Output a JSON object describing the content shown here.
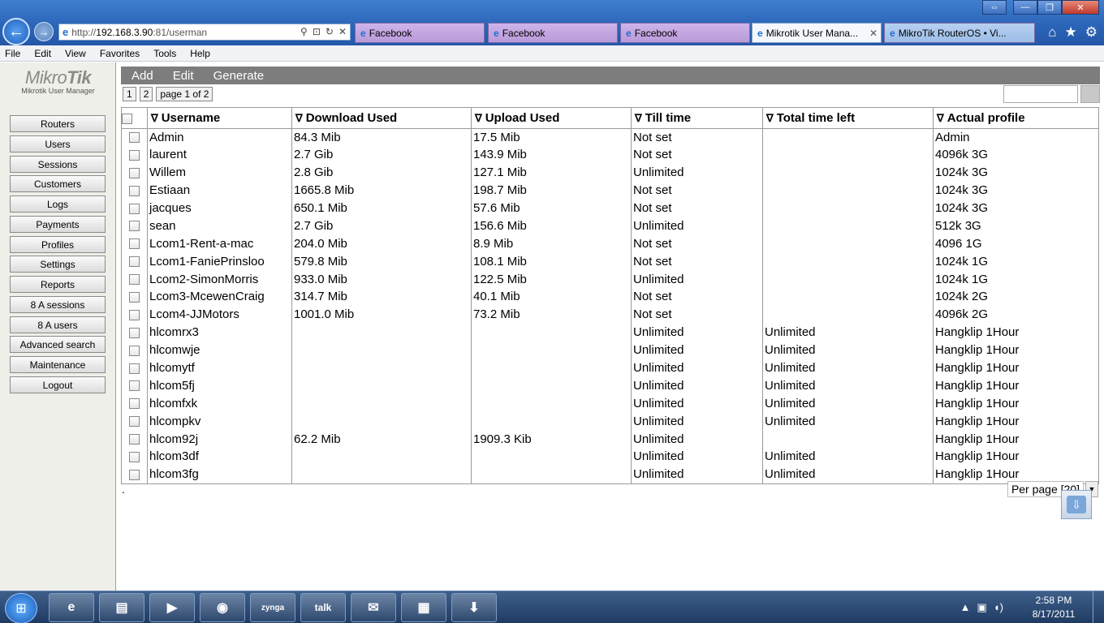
{
  "browser": {
    "address": {
      "prefix": "http://",
      "host": "192.168.3.90",
      "suffix": ":81/userman"
    },
    "tabs": [
      {
        "label": "Facebook",
        "active": false
      },
      {
        "label": "Facebook",
        "active": false
      },
      {
        "label": "Facebook",
        "active": false
      },
      {
        "label": "Mikrotik User Mana...",
        "active": true
      },
      {
        "label": "MikroTik RouterOS • Vi...",
        "active": false
      }
    ],
    "menu": [
      "File",
      "Edit",
      "View",
      "Favorites",
      "Tools",
      "Help"
    ]
  },
  "logo": {
    "main_a": "Mikro",
    "main_b": "Tik",
    "sub": "Mikrotik User Manager"
  },
  "sidebar": {
    "items": [
      "Routers",
      "Users",
      "Sessions",
      "Customers",
      "Logs",
      "Payments",
      "Profiles",
      "Settings",
      "Reports",
      "8 A sessions",
      "8 A users",
      "Advanced search",
      "Maintenance",
      "Logout"
    ]
  },
  "toolbar": {
    "add": "Add",
    "edit": "Edit",
    "generate": "Generate"
  },
  "pager": {
    "p1": "1",
    "p2": "2",
    "info": "page 1 of 2"
  },
  "table": {
    "sort_glyph": "∇",
    "headers": [
      "Username",
      "Download Used",
      "Upload Used",
      "Till time",
      "Total time left",
      "Actual profile"
    ],
    "rows": [
      [
        "Admin",
        "84.3 Mib",
        "17.5 Mib",
        "Not set",
        "",
        "Admin"
      ],
      [
        "laurent",
        "2.7 Gib",
        "143.9 Mib",
        "Not set",
        "",
        "4096k 3G"
      ],
      [
        "Willem",
        "2.8 Gib",
        "127.1 Mib",
        "Unlimited",
        "",
        "1024k 3G"
      ],
      [
        "Estiaan",
        "1665.8 Mib",
        "198.7 Mib",
        "Not set",
        "",
        "1024k 3G"
      ],
      [
        "jacques",
        "650.1 Mib",
        "57.6 Mib",
        "Not set",
        "",
        "1024k 3G"
      ],
      [
        "sean",
        "2.7 Gib",
        "156.6 Mib",
        "Unlimited",
        "",
        "512k 3G"
      ],
      [
        "Lcom1-Rent-a-mac",
        "204.0 Mib",
        "8.9 Mib",
        "Not set",
        "",
        "4096 1G"
      ],
      [
        "Lcom1-FaniePrinsloo",
        "579.8 Mib",
        "108.1 Mib",
        "Not set",
        "",
        "1024k 1G"
      ],
      [
        "Lcom2-SimonMorris",
        "933.0 Mib",
        "122.5 Mib",
        "Unlimited",
        "",
        "1024k 1G"
      ],
      [
        "Lcom3-McewenCraig",
        "314.7 Mib",
        "40.1 Mib",
        "Not set",
        "",
        "1024k 2G"
      ],
      [
        "Lcom4-JJMotors",
        "1001.0 Mib",
        "73.2 Mib",
        "Not set",
        "",
        "4096k 2G"
      ],
      [
        "hlcomrx3",
        "",
        "",
        "Unlimited",
        "Unlimited",
        "Hangklip 1Hour"
      ],
      [
        "hlcomwje",
        "",
        "",
        "Unlimited",
        "Unlimited",
        "Hangklip 1Hour"
      ],
      [
        "hlcomytf",
        "",
        "",
        "Unlimited",
        "Unlimited",
        "Hangklip 1Hour"
      ],
      [
        "hlcom5fj",
        "",
        "",
        "Unlimited",
        "Unlimited",
        "Hangklip 1Hour"
      ],
      [
        "hlcomfxk",
        "",
        "",
        "Unlimited",
        "Unlimited",
        "Hangklip 1Hour"
      ],
      [
        "hlcompkv",
        "",
        "",
        "Unlimited",
        "Unlimited",
        "Hangklip 1Hour"
      ],
      [
        "hlcom92j",
        "62.2 Mib",
        "1909.3 Kib",
        "Unlimited",
        "",
        "Hangklip 1Hour"
      ],
      [
        "hlcom3df",
        "",
        "",
        "Unlimited",
        "Unlimited",
        "Hangklip 1Hour"
      ],
      [
        "hlcom3fg",
        "",
        "",
        "Unlimited",
        "Unlimited",
        "Hangklip 1Hour"
      ]
    ]
  },
  "footer": {
    "dot": ".",
    "per_page": "Per page [20]"
  },
  "taskbar": {
    "apps": [
      "ie-icon",
      "explorer-icon",
      "media-player-icon",
      "firefox-icon",
      "zynga-icon",
      "gtalk-icon",
      "outlook-icon",
      "winrar-icon",
      "download-icon"
    ],
    "zynga_label": "zynga",
    "talk_label": "talk",
    "time": "2:58 PM",
    "date": "8/17/2011"
  },
  "colors": {
    "toolbar_bg": "#7d7d7d",
    "sidebar_bg": "#efefe9",
    "chrome_blue": "#2a63b6"
  }
}
